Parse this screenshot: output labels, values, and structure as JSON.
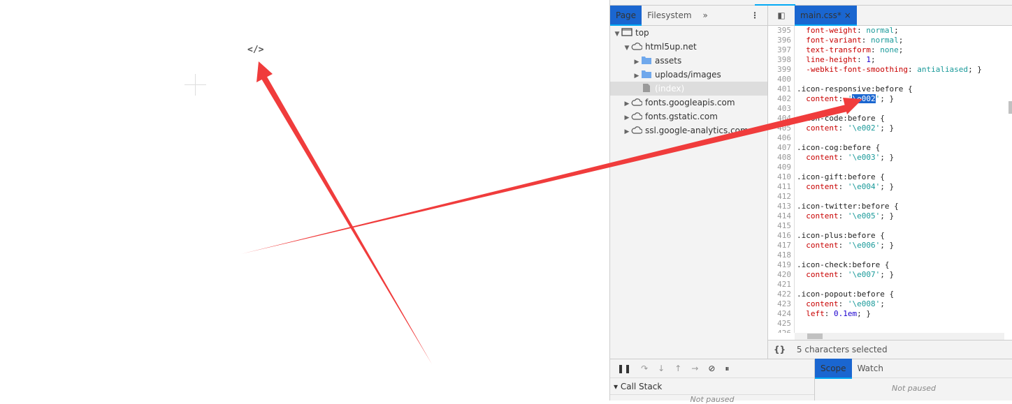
{
  "page": {
    "glyph": "</>"
  },
  "navigator": {
    "tabs": [
      "Page",
      "Filesystem",
      "»"
    ],
    "tree": [
      {
        "label": "top",
        "icon": "frame-icon",
        "depth": 0,
        "open": true
      },
      {
        "label": "html5up.net",
        "icon": "cloud-icon",
        "depth": 1,
        "open": true
      },
      {
        "label": "assets",
        "icon": "folder-icon",
        "depth": 2,
        "open": false
      },
      {
        "label": "uploads/images",
        "icon": "folder-icon",
        "depth": 2,
        "open": false
      },
      {
        "label": "(index)",
        "icon": "file-icon",
        "depth": 2,
        "selected": true
      },
      {
        "label": "fonts.googleapis.com",
        "icon": "cloud-icon",
        "depth": 1,
        "open": false
      },
      {
        "label": "fonts.gstatic.com",
        "icon": "cloud-icon",
        "depth": 1,
        "open": false
      },
      {
        "label": "ssl.google-analytics.com",
        "icon": "cloud-icon",
        "depth": 1,
        "open": false
      }
    ]
  },
  "editor": {
    "tab": "main.css*",
    "first_line": 395,
    "lines": [
      [
        [
          "",
          "  "
        ],
        [
          "p",
          "font-weight"
        ],
        [
          "",
          ": "
        ],
        [
          "v",
          "normal"
        ],
        [
          "",
          ";"
        ]
      ],
      [
        [
          "",
          "  "
        ],
        [
          "p",
          "font-variant"
        ],
        [
          "",
          ": "
        ],
        [
          "v",
          "normal"
        ],
        [
          "",
          ";"
        ]
      ],
      [
        [
          "",
          "  "
        ],
        [
          "p",
          "text-transform"
        ],
        [
          "",
          ": "
        ],
        [
          "v",
          "none"
        ],
        [
          "",
          ";"
        ]
      ],
      [
        [
          "",
          "  "
        ],
        [
          "p",
          "line-height"
        ],
        [
          "",
          ": "
        ],
        [
          "n",
          "1"
        ],
        [
          "",
          ";"
        ]
      ],
      [
        [
          "",
          "  "
        ],
        [
          "p",
          "-webkit-font-smoothing"
        ],
        [
          "",
          ": "
        ],
        [
          "v",
          "antialiased"
        ],
        [
          "",
          "; }"
        ]
      ],
      [],
      [
        [
          "",
          ".icon-responsive:before {"
        ]
      ],
      [
        [
          "",
          "  "
        ],
        [
          "p",
          "content"
        ],
        [
          "",
          ": "
        ],
        [
          "s",
          "'"
        ],
        [
          "sel",
          "\\e002"
        ],
        [
          "s",
          "'"
        ],
        [
          "",
          "; }"
        ]
      ],
      [],
      [
        [
          "",
          ".icon-code:before {"
        ]
      ],
      [
        [
          "",
          "  "
        ],
        [
          "p",
          "content"
        ],
        [
          "",
          ": "
        ],
        [
          "s",
          "'\\e002'"
        ],
        [
          "",
          "; }"
        ]
      ],
      [],
      [
        [
          "",
          ".icon-cog:before {"
        ]
      ],
      [
        [
          "",
          "  "
        ],
        [
          "p",
          "content"
        ],
        [
          "",
          ": "
        ],
        [
          "s",
          "'\\e003'"
        ],
        [
          "",
          "; }"
        ]
      ],
      [],
      [
        [
          "",
          ".icon-gift:before {"
        ]
      ],
      [
        [
          "",
          "  "
        ],
        [
          "p",
          "content"
        ],
        [
          "",
          ": "
        ],
        [
          "s",
          "'\\e004'"
        ],
        [
          "",
          "; }"
        ]
      ],
      [],
      [
        [
          "",
          ".icon-twitter:before {"
        ]
      ],
      [
        [
          "",
          "  "
        ],
        [
          "p",
          "content"
        ],
        [
          "",
          ": "
        ],
        [
          "s",
          "'\\e005'"
        ],
        [
          "",
          "; }"
        ]
      ],
      [],
      [
        [
          "",
          ".icon-plus:before {"
        ]
      ],
      [
        [
          "",
          "  "
        ],
        [
          "p",
          "content"
        ],
        [
          "",
          ": "
        ],
        [
          "s",
          "'\\e006'"
        ],
        [
          "",
          "; }"
        ]
      ],
      [],
      [
        [
          "",
          ".icon-check:before {"
        ]
      ],
      [
        [
          "",
          "  "
        ],
        [
          "p",
          "content"
        ],
        [
          "",
          ": "
        ],
        [
          "s",
          "'\\e007'"
        ],
        [
          "",
          "; }"
        ]
      ],
      [],
      [
        [
          "",
          ".icon-popout:before {"
        ]
      ],
      [
        [
          "",
          "  "
        ],
        [
          "p",
          "content"
        ],
        [
          "",
          ": "
        ],
        [
          "s",
          "'\\e008'"
        ],
        [
          "",
          ";"
        ]
      ],
      [
        [
          "",
          "  "
        ],
        [
          "p",
          "left"
        ],
        [
          "",
          ": "
        ],
        [
          "n",
          "0.1em"
        ],
        [
          "",
          "; }"
        ]
      ],
      [],
      [],
      []
    ],
    "status": "5 characters selected",
    "status_icon": "{}"
  },
  "debugger": {
    "callstack_label": "Call Stack",
    "callstack_empty": "Not paused",
    "side_tabs": [
      "Scope",
      "Watch"
    ],
    "side_empty": "Not paused"
  },
  "colors": {
    "accent": "#03a9f4",
    "arrow": "#f03c3c",
    "selection": "#1a66d0"
  }
}
